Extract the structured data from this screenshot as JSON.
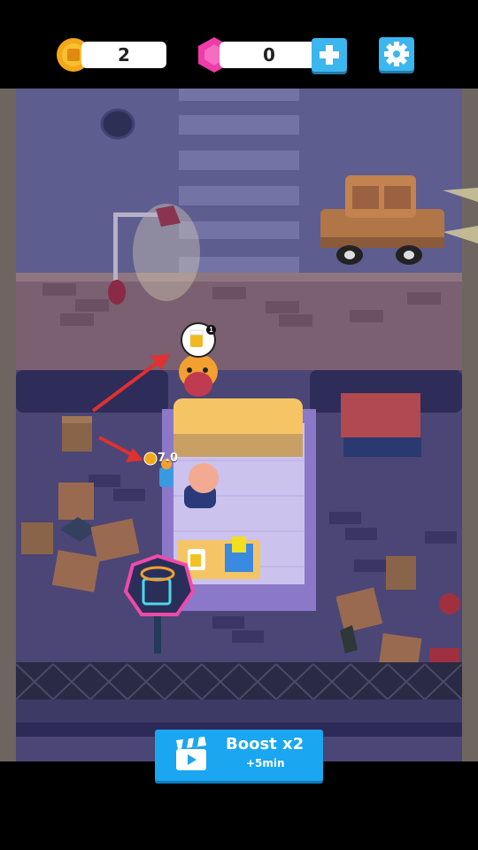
{
  "hud": {
    "coins": "2",
    "gems": "0",
    "coin_icon": "coin-icon",
    "gem_icon": "pink-gem-icon",
    "add_icon": "plus-icon",
    "settings_icon": "gear-icon"
  },
  "scene": {
    "price_label": "7.0",
    "order_count": "1",
    "order_icon": "beer-mug-icon"
  },
  "boost_button": {
    "title": "Boost x2",
    "subtitle": "+5min",
    "icon": "clapperboard-icon"
  },
  "colors": {
    "hud_bar": "#ffffff",
    "button_blue": "#3cb6ee",
    "boost_blue": "#1aa6f0",
    "street": "#5e5d8f",
    "counter_top": "#f5c565",
    "floor": "#ccc2ee",
    "neon_pink": "#f04aa8"
  }
}
